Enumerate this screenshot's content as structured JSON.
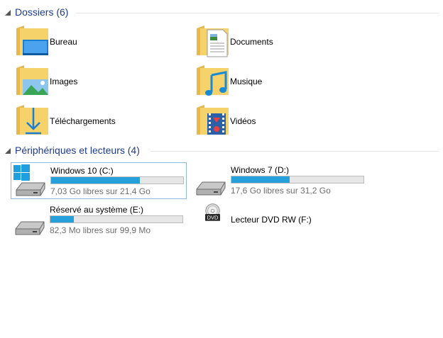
{
  "folders_group": {
    "title": "Dossiers (6)",
    "items": [
      {
        "label": "Bureau",
        "icon": "desktop-folder-icon"
      },
      {
        "label": "Documents",
        "icon": "documents-folder-icon"
      },
      {
        "label": "Images",
        "icon": "pictures-folder-icon"
      },
      {
        "label": "Musique",
        "icon": "music-folder-icon"
      },
      {
        "label": "Téléchargements",
        "icon": "downloads-folder-icon"
      },
      {
        "label": "Vidéos",
        "icon": "videos-folder-icon"
      }
    ]
  },
  "drives_group": {
    "title": "Périphériques et lecteurs (4)",
    "drives": [
      {
        "name": "Windows 10 (C:)",
        "info": "7,03 Go libres sur 21,4 Go",
        "used_fraction": 0.67,
        "icon": "windows-drive-icon"
      },
      {
        "name": "Windows 7 (D:)",
        "info": "17,6 Go libres sur 31,2 Go",
        "used_fraction": 0.44,
        "icon": "hard-drive-icon"
      },
      {
        "name": "Réservé au système (E:)",
        "info": "82,3 Mo libres sur 99,9 Mo",
        "used_fraction": 0.18,
        "icon": "hard-drive-icon"
      }
    ],
    "dvd": {
      "name": "Lecteur DVD RW (F:)",
      "badge": "DVD",
      "icon": "dvd-drive-icon"
    }
  },
  "colors": {
    "group_title": "#1e3b8f",
    "bar_fill": "#26a0da",
    "selection_border": "#8fb7e0",
    "folder_yellow": "#f6d26b"
  }
}
